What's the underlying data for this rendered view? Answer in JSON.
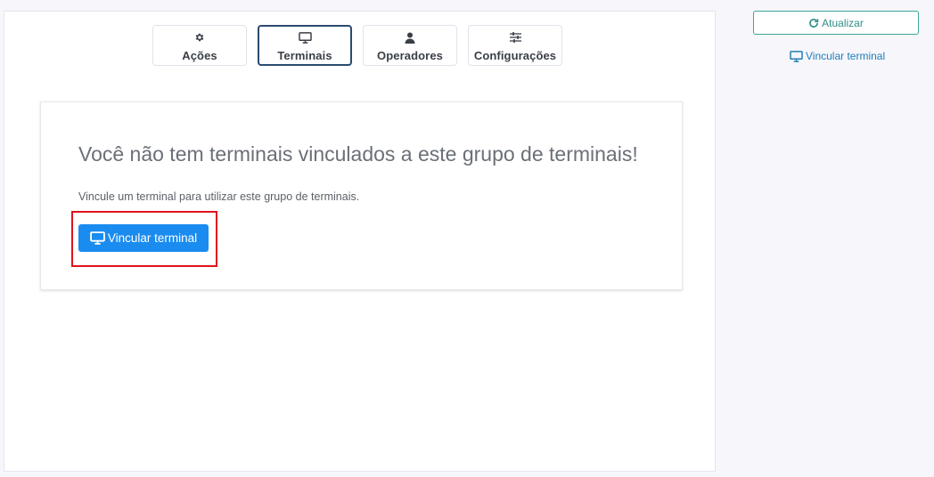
{
  "tabs": [
    {
      "label": "Ações",
      "icon": "gear-icon",
      "active": false
    },
    {
      "label": "Terminais",
      "icon": "monitor-icon",
      "active": true
    },
    {
      "label": "Operadores",
      "icon": "user-icon",
      "active": false
    },
    {
      "label": "Configurações",
      "icon": "sliders-icon",
      "active": false
    }
  ],
  "empty_state": {
    "title": "Você não tem terminais vinculados a este grupo de terminais!",
    "subtitle": "Vincule um terminal para utilizar este grupo de terminais.",
    "button_label": "Vincular terminal",
    "button_icon": "monitor-icon"
  },
  "sidebar": {
    "refresh_label": "Atualizar",
    "refresh_icon": "refresh-icon",
    "link_label": "Vincular terminal",
    "link_icon": "monitor-icon"
  },
  "colors": {
    "primary": "#1a8cf0",
    "refresh_border": "#3aa69a",
    "link": "#1f7fb8",
    "highlight": "#e0141b",
    "active_tab_border": "#2c4a6e"
  }
}
